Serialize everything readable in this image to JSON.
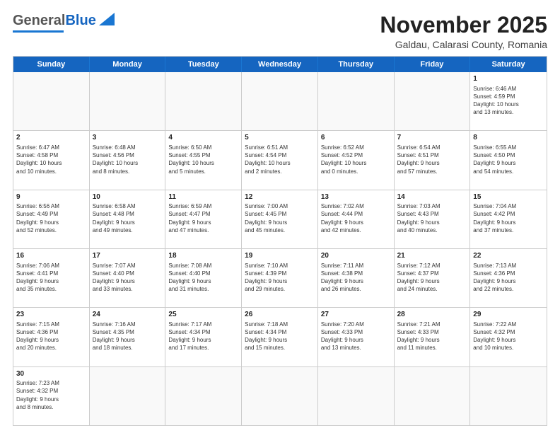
{
  "header": {
    "logo_general": "General",
    "logo_blue": "Blue",
    "month_year": "November 2025",
    "location": "Galdau, Calarasi County, Romania"
  },
  "days_of_week": [
    "Sunday",
    "Monday",
    "Tuesday",
    "Wednesday",
    "Thursday",
    "Friday",
    "Saturday"
  ],
  "weeks": [
    [
      {
        "num": "",
        "info": ""
      },
      {
        "num": "",
        "info": ""
      },
      {
        "num": "",
        "info": ""
      },
      {
        "num": "",
        "info": ""
      },
      {
        "num": "",
        "info": ""
      },
      {
        "num": "",
        "info": ""
      },
      {
        "num": "1",
        "info": "Sunrise: 6:46 AM\nSunset: 4:59 PM\nDaylight: 10 hours\nand 13 minutes."
      }
    ],
    [
      {
        "num": "2",
        "info": "Sunrise: 6:47 AM\nSunset: 4:58 PM\nDaylight: 10 hours\nand 10 minutes."
      },
      {
        "num": "3",
        "info": "Sunrise: 6:48 AM\nSunset: 4:56 PM\nDaylight: 10 hours\nand 8 minutes."
      },
      {
        "num": "4",
        "info": "Sunrise: 6:50 AM\nSunset: 4:55 PM\nDaylight: 10 hours\nand 5 minutes."
      },
      {
        "num": "5",
        "info": "Sunrise: 6:51 AM\nSunset: 4:54 PM\nDaylight: 10 hours\nand 2 minutes."
      },
      {
        "num": "6",
        "info": "Sunrise: 6:52 AM\nSunset: 4:52 PM\nDaylight: 10 hours\nand 0 minutes."
      },
      {
        "num": "7",
        "info": "Sunrise: 6:54 AM\nSunset: 4:51 PM\nDaylight: 9 hours\nand 57 minutes."
      },
      {
        "num": "8",
        "info": "Sunrise: 6:55 AM\nSunset: 4:50 PM\nDaylight: 9 hours\nand 54 minutes."
      }
    ],
    [
      {
        "num": "9",
        "info": "Sunrise: 6:56 AM\nSunset: 4:49 PM\nDaylight: 9 hours\nand 52 minutes."
      },
      {
        "num": "10",
        "info": "Sunrise: 6:58 AM\nSunset: 4:48 PM\nDaylight: 9 hours\nand 49 minutes."
      },
      {
        "num": "11",
        "info": "Sunrise: 6:59 AM\nSunset: 4:47 PM\nDaylight: 9 hours\nand 47 minutes."
      },
      {
        "num": "12",
        "info": "Sunrise: 7:00 AM\nSunset: 4:45 PM\nDaylight: 9 hours\nand 45 minutes."
      },
      {
        "num": "13",
        "info": "Sunrise: 7:02 AM\nSunset: 4:44 PM\nDaylight: 9 hours\nand 42 minutes."
      },
      {
        "num": "14",
        "info": "Sunrise: 7:03 AM\nSunset: 4:43 PM\nDaylight: 9 hours\nand 40 minutes."
      },
      {
        "num": "15",
        "info": "Sunrise: 7:04 AM\nSunset: 4:42 PM\nDaylight: 9 hours\nand 37 minutes."
      }
    ],
    [
      {
        "num": "16",
        "info": "Sunrise: 7:06 AM\nSunset: 4:41 PM\nDaylight: 9 hours\nand 35 minutes."
      },
      {
        "num": "17",
        "info": "Sunrise: 7:07 AM\nSunset: 4:40 PM\nDaylight: 9 hours\nand 33 minutes."
      },
      {
        "num": "18",
        "info": "Sunrise: 7:08 AM\nSunset: 4:40 PM\nDaylight: 9 hours\nand 31 minutes."
      },
      {
        "num": "19",
        "info": "Sunrise: 7:10 AM\nSunset: 4:39 PM\nDaylight: 9 hours\nand 29 minutes."
      },
      {
        "num": "20",
        "info": "Sunrise: 7:11 AM\nSunset: 4:38 PM\nDaylight: 9 hours\nand 26 minutes."
      },
      {
        "num": "21",
        "info": "Sunrise: 7:12 AM\nSunset: 4:37 PM\nDaylight: 9 hours\nand 24 minutes."
      },
      {
        "num": "22",
        "info": "Sunrise: 7:13 AM\nSunset: 4:36 PM\nDaylight: 9 hours\nand 22 minutes."
      }
    ],
    [
      {
        "num": "23",
        "info": "Sunrise: 7:15 AM\nSunset: 4:36 PM\nDaylight: 9 hours\nand 20 minutes."
      },
      {
        "num": "24",
        "info": "Sunrise: 7:16 AM\nSunset: 4:35 PM\nDaylight: 9 hours\nand 18 minutes."
      },
      {
        "num": "25",
        "info": "Sunrise: 7:17 AM\nSunset: 4:34 PM\nDaylight: 9 hours\nand 17 minutes."
      },
      {
        "num": "26",
        "info": "Sunrise: 7:18 AM\nSunset: 4:34 PM\nDaylight: 9 hours\nand 15 minutes."
      },
      {
        "num": "27",
        "info": "Sunrise: 7:20 AM\nSunset: 4:33 PM\nDaylight: 9 hours\nand 13 minutes."
      },
      {
        "num": "28",
        "info": "Sunrise: 7:21 AM\nSunset: 4:33 PM\nDaylight: 9 hours\nand 11 minutes."
      },
      {
        "num": "29",
        "info": "Sunrise: 7:22 AM\nSunset: 4:32 PM\nDaylight: 9 hours\nand 10 minutes."
      }
    ],
    [
      {
        "num": "30",
        "info": "Sunrise: 7:23 AM\nSunset: 4:32 PM\nDaylight: 9 hours\nand 8 minutes."
      },
      {
        "num": "",
        "info": ""
      },
      {
        "num": "",
        "info": ""
      },
      {
        "num": "",
        "info": ""
      },
      {
        "num": "",
        "info": ""
      },
      {
        "num": "",
        "info": ""
      },
      {
        "num": "",
        "info": ""
      }
    ]
  ]
}
